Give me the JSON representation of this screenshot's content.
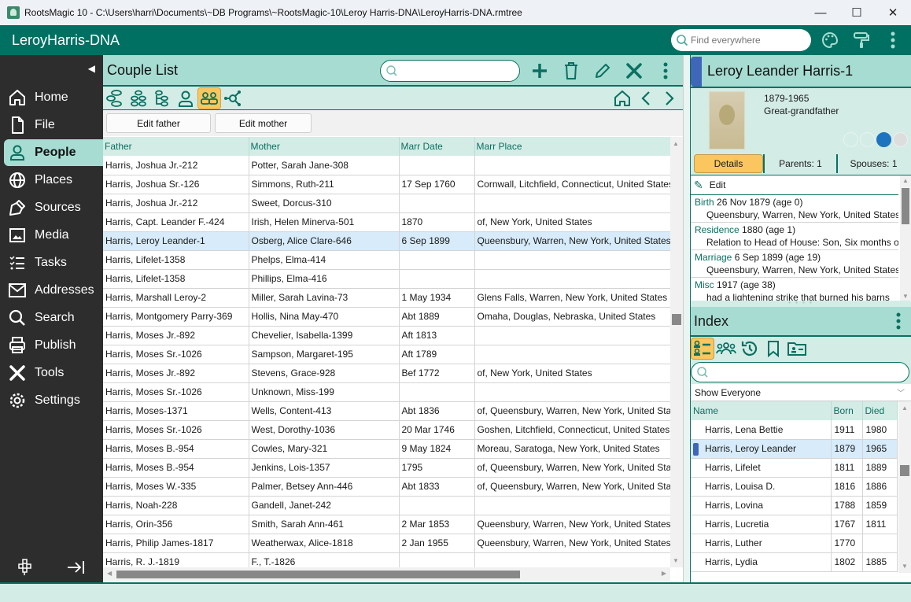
{
  "window": {
    "title": "RootsMagic 10 - C:\\Users\\harri\\Documents\\~DB Programs\\~RootsMagic-10\\Leroy Harris-DNA\\LeroyHarris-DNA.rmtree",
    "minimize": "—",
    "maximize": "☐",
    "close": "✕"
  },
  "appbar": {
    "database_name": "LeroyHarris-DNA",
    "find_placeholder": "Find everywhere"
  },
  "sidebar": {
    "items": [
      {
        "label": "Home",
        "icon": "home-icon"
      },
      {
        "label": "File",
        "icon": "file-icon"
      },
      {
        "label": "People",
        "icon": "person-icon",
        "active": true
      },
      {
        "label": "Places",
        "icon": "globe-icon"
      },
      {
        "label": "Sources",
        "icon": "pen-nib-icon"
      },
      {
        "label": "Media",
        "icon": "image-icon"
      },
      {
        "label": "Tasks",
        "icon": "checklist-icon"
      },
      {
        "label": "Addresses",
        "icon": "envelope-icon"
      },
      {
        "label": "Search",
        "icon": "search-icon"
      },
      {
        "label": "Publish",
        "icon": "printer-icon"
      },
      {
        "label": "Tools",
        "icon": "tools-icon"
      },
      {
        "label": "Settings",
        "icon": "gear-icon"
      }
    ]
  },
  "main": {
    "title": "Couple List",
    "search_value": "",
    "buttons": {
      "edit_father": "Edit father",
      "edit_mother": "Edit mother"
    },
    "columns": [
      "Father",
      "Mother",
      "Marr Date",
      "Marr Place"
    ],
    "rows": [
      [
        "Harris, Joshua Jr.-212",
        "Potter, Sarah Jane-308",
        "",
        ""
      ],
      [
        "Harris, Joshua Sr.-126",
        "Simmons, Ruth-211",
        "17 Sep 1760",
        "Cornwall, Litchfield, Connecticut, United States"
      ],
      [
        "Harris, Joshua Jr.-212",
        "Sweet, Dorcus-310",
        "",
        ""
      ],
      [
        "Harris, Capt. Leander F.-424",
        "Irish, Helen Minerva-501",
        "1870",
        "of, New York, United States"
      ],
      [
        "Harris, Leroy Leander-1",
        "Osberg, Alice Clare-646",
        "6 Sep 1899",
        "Queensbury, Warren, New York, United States"
      ],
      [
        "Harris, Lifelet-1358",
        "Phelps, Elma-414",
        "",
        ""
      ],
      [
        "Harris, Lifelet-1358",
        "Phillips, Elma-416",
        "",
        ""
      ],
      [
        "Harris, Marshall Leroy-2",
        "Miller, Sarah Lavina-73",
        "1 May 1934",
        "Glens Falls, Warren, New York, United States"
      ],
      [
        "Harris, Montgomery Parry-369",
        "Hollis, Nina May-470",
        "Abt 1889",
        "Omaha, Douglas, Nebraska, United States"
      ],
      [
        "Harris, Moses Jr.-892",
        "Chevelier, Isabella-1399",
        "Aft 1813",
        ""
      ],
      [
        "Harris, Moses Sr.-1026",
        "Sampson, Margaret-195",
        "Aft 1789",
        ""
      ],
      [
        "Harris, Moses Jr.-892",
        "Stevens, Grace-928",
        "Bef 1772",
        "of, New York, United States"
      ],
      [
        "Harris, Moses Sr.-1026",
        "Unknown, Miss-199",
        "",
        ""
      ],
      [
        "Harris, Moses-1371",
        "Wells, Content-413",
        "Abt 1836",
        "of, Queensbury, Warren, New York, United States"
      ],
      [
        "Harris, Moses Sr.-1026",
        "West, Dorothy-1036",
        "20 Mar 1746",
        "Goshen, Litchfield, Connecticut, United States"
      ],
      [
        "Harris, Moses B.-954",
        "Cowles, Mary-321",
        "9 May 1824",
        "Moreau, Saratoga, New York, United States"
      ],
      [
        "Harris, Moses B.-954",
        "Jenkins, Lois-1357",
        "1795",
        "of, Queensbury, Warren, New York, United States"
      ],
      [
        "Harris, Moses W.-335",
        "Palmer, Betsey Ann-446",
        "Abt 1833",
        "of, Queensbury, Warren, New York, United States"
      ],
      [
        "Harris, Noah-228",
        "Gandell, Janet-242",
        "",
        ""
      ],
      [
        "Harris, Orin-356",
        "Smith, Sarah Ann-461",
        "2 Mar 1853",
        "Queensbury, Warren, New York, United States"
      ],
      [
        "Harris, Philip James-1817",
        "Weatherwax, Alice-1818",
        "2 Jan 1955",
        "Queensbury, Warren, New York, United States"
      ],
      [
        "Harris, R. J.-1819",
        "F., T.-1826",
        "",
        ""
      ]
    ],
    "selected_row": 4
  },
  "person": {
    "name": "Leroy Leander Harris-1",
    "lifespan": "1879-1965",
    "relationship": "Great-grandfather",
    "tabs": {
      "details": "Details",
      "parents": "Parents: 1",
      "spouses": "Spouses: 1"
    },
    "edit_label": "Edit",
    "events": [
      {
        "type": "Birth",
        "date": "26 Nov 1879 (age 0)",
        "detail": "Queensbury, Warren, New York, United States"
      },
      {
        "type": "Residence",
        "date": "1880 (age 1)",
        "detail": "Relation to Head of House: Son, Six months old"
      },
      {
        "type": "Marriage",
        "date": "6 Sep 1899 (age 19)",
        "detail": "Queensbury, Warren, New York, United States"
      },
      {
        "type": "Misc",
        "date": "1917 (age 38)",
        "detail": "had a  lightening strike that burned his barns"
      }
    ]
  },
  "index": {
    "title": "Index",
    "filter": "Show Everyone",
    "search_value": "",
    "columns": [
      "Name",
      "Born",
      "Died"
    ],
    "rows": [
      [
        "Harris, Lena Bettie",
        "1911",
        "1980"
      ],
      [
        "Harris, Leroy Leander",
        "1879",
        "1965"
      ],
      [
        "Harris, Lifelet",
        "1811",
        "1889"
      ],
      [
        "Harris, Louisa D.",
        "1816",
        "1886"
      ],
      [
        "Harris, Lovina",
        "1788",
        "1859"
      ],
      [
        "Harris, Lucretia",
        "1767",
        "1811"
      ],
      [
        "Harris, Luther",
        "1770",
        ""
      ],
      [
        "Harris, Lydia",
        "1802",
        "1885"
      ]
    ],
    "selected_row": 1
  },
  "colors": {
    "brand": "#007062",
    "header_teal": "#a7dcd2",
    "light_teal": "#d3ece6",
    "active_yellow": "#fbc65d",
    "sidebar_bg": "#2d2d2d",
    "selection": "#d7ebfa",
    "marker_blue": "#3f66b8"
  }
}
